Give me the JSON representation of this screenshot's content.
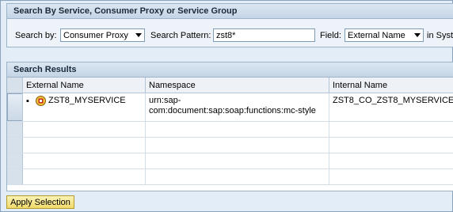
{
  "search_panel": {
    "title": "Search By Service, Consumer Proxy or Service Group",
    "search_by_label": "Search by:",
    "search_by_value": "Consumer Proxy",
    "search_pattern_label": "Search Pattern:",
    "search_pattern_value": "zst8*",
    "field_label": "Field:",
    "field_value": "External Name",
    "trailing_label": "in Syst"
  },
  "results_panel": {
    "title": "Search Results",
    "columns": [
      "External Name",
      "Namespace",
      "Internal Name"
    ],
    "rows": [
      {
        "bullet": "▪",
        "icon": "service-icon",
        "external_name": "ZST8_MYSERVICE",
        "namespace": "urn:sap-com:document:sap:soap:functions:mc-style",
        "internal_name": "ZST8_CO_ZST8_MYSERVICE"
      }
    ]
  },
  "apply_button_label": "Apply Selection",
  "colors": {
    "background": "#e3edf7",
    "panel_header": "#c5d5e6",
    "button": "#f1da6a"
  }
}
